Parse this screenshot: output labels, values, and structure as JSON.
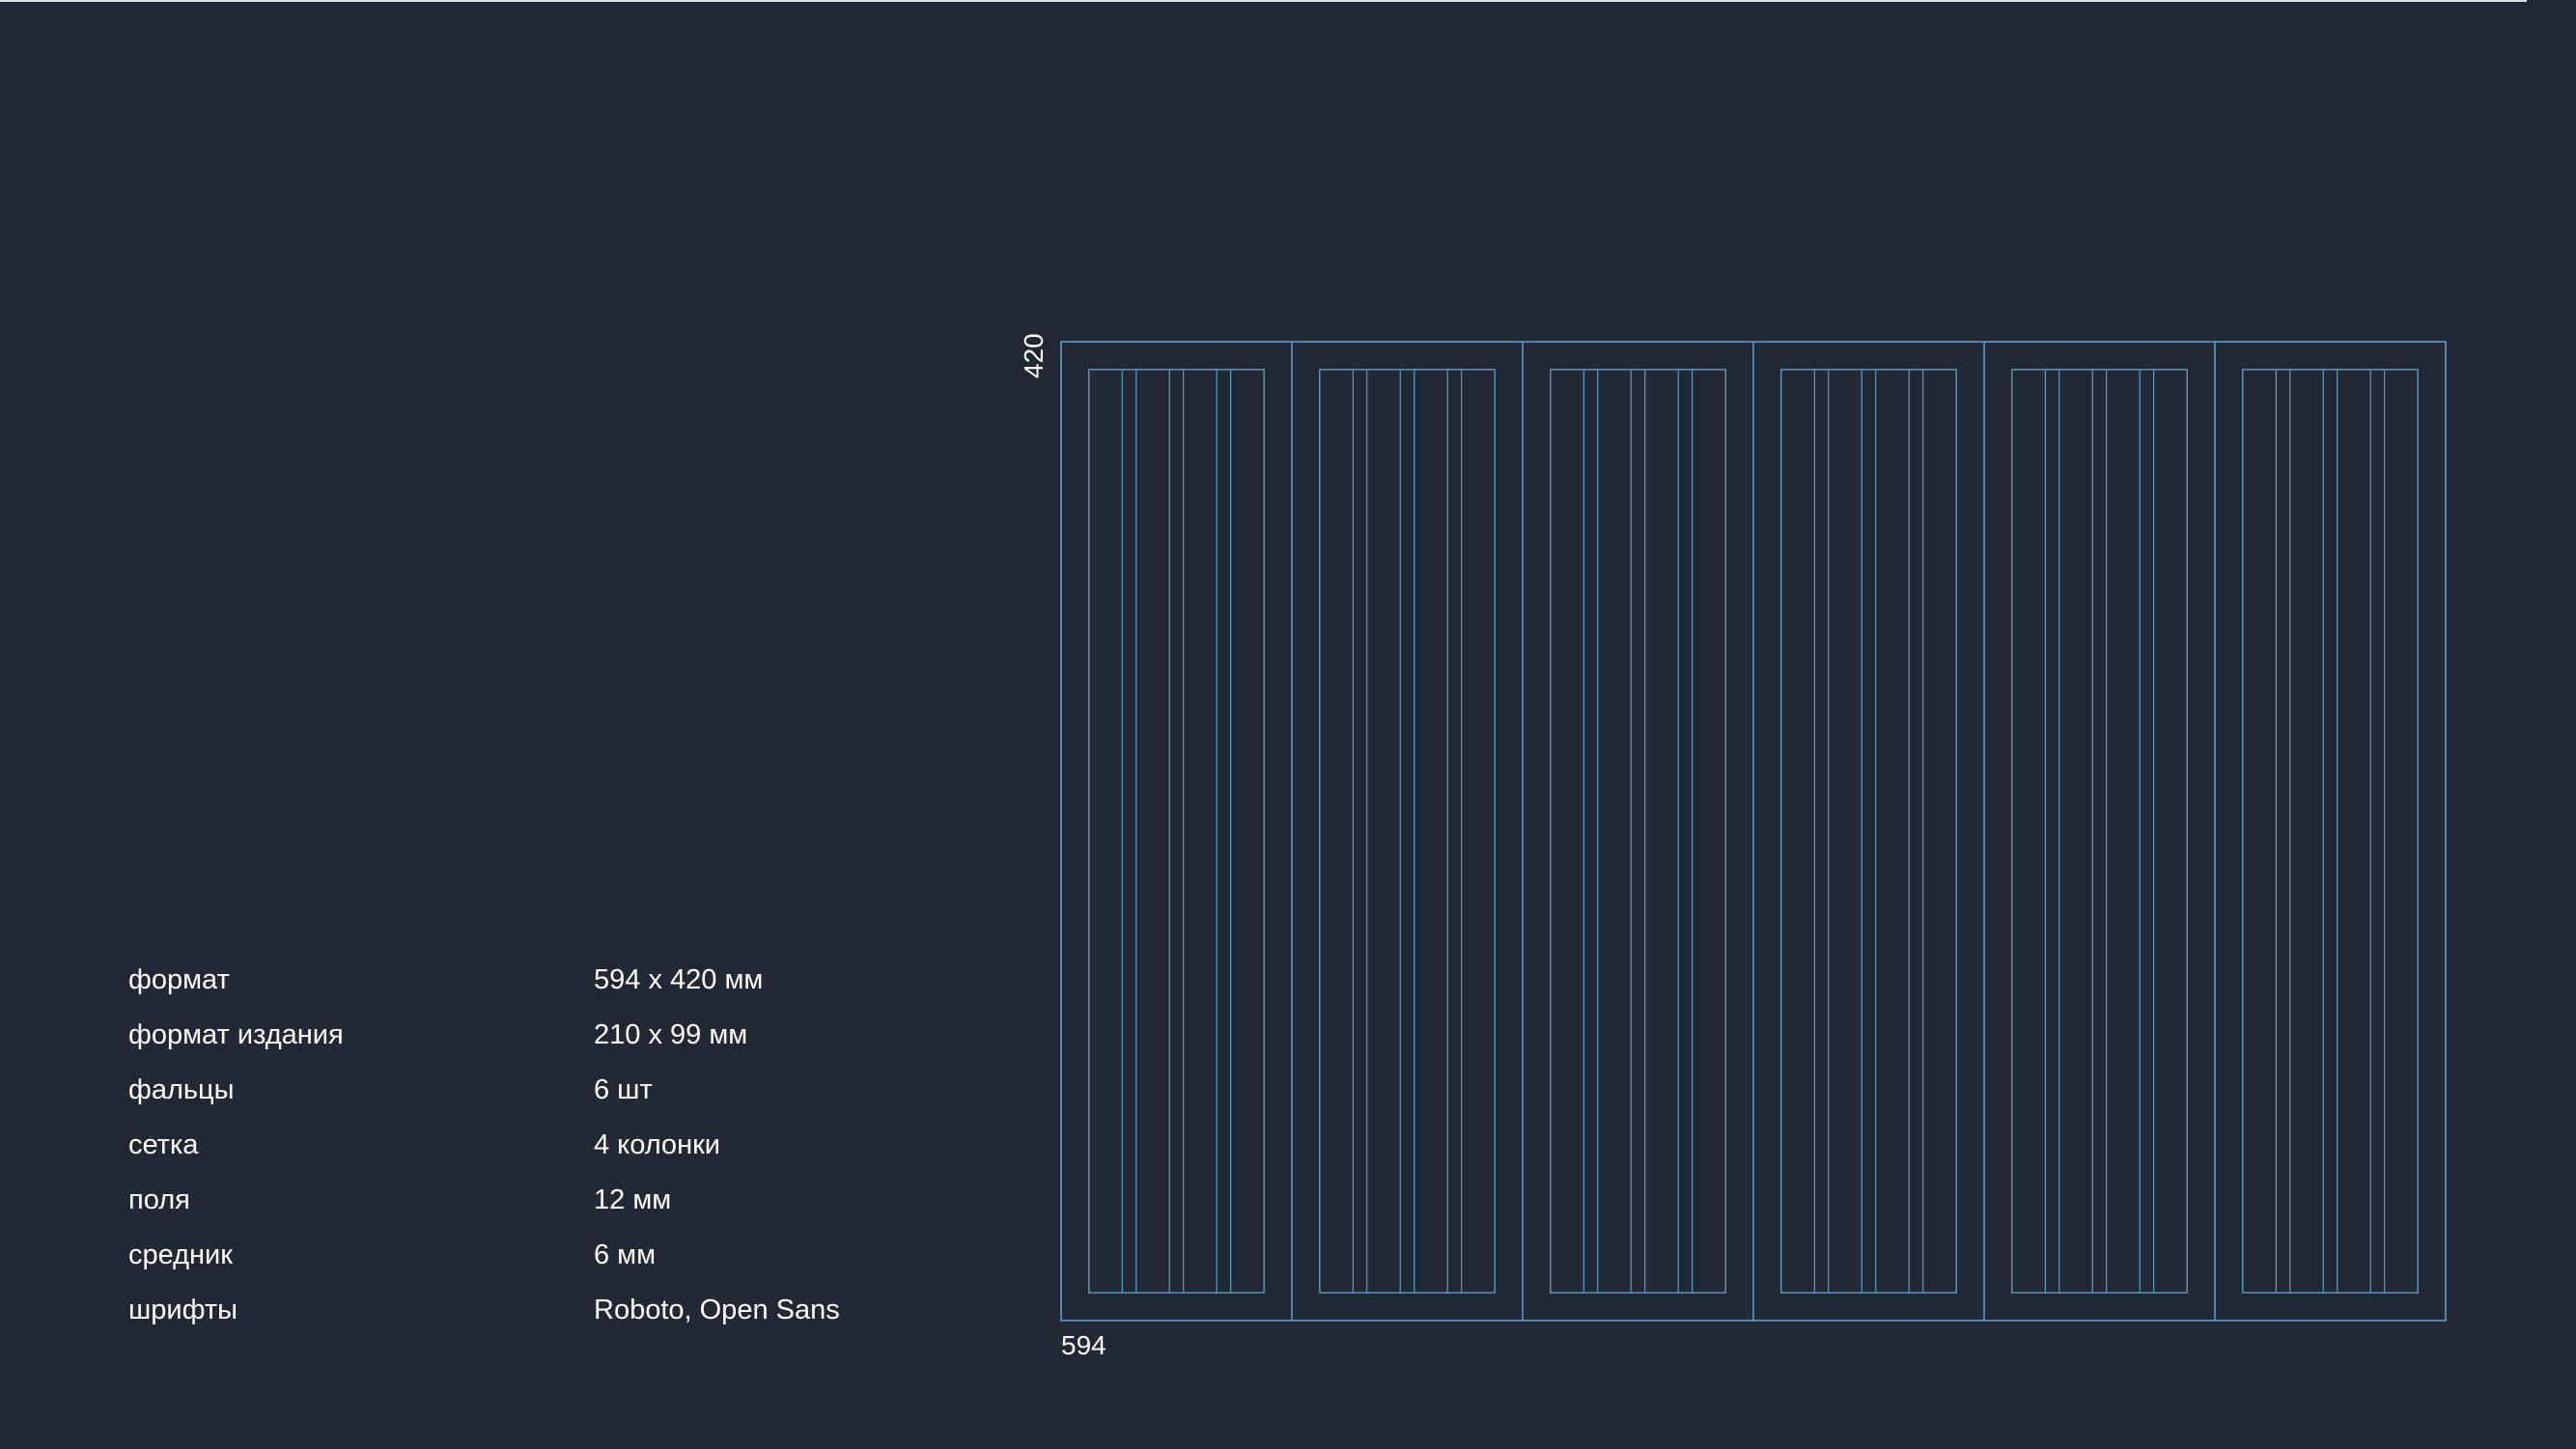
{
  "specs": [
    {
      "label": "формат",
      "value": "594 x 420 мм"
    },
    {
      "label": "формат издания",
      "value": "210 x 99 мм"
    },
    {
      "label": "фальцы",
      "value": "6 шт"
    },
    {
      "label": "сетка",
      "value": "4 колонки"
    },
    {
      "label": "поля",
      "value": "12 мм"
    },
    {
      "label": "средник",
      "value": "6 мм"
    },
    {
      "label": "шрифты",
      "value": "Roboto, Open Sans"
    }
  ],
  "diagram": {
    "width_label": "594",
    "height_label": "420",
    "sheet_width_mm": 594,
    "sheet_height_mm": 420,
    "panels": 6,
    "columns_per_panel": 4,
    "margin_mm": 12,
    "gutter_mm": 6,
    "line_color": "#5a9ec9",
    "background_color": "#222834"
  }
}
